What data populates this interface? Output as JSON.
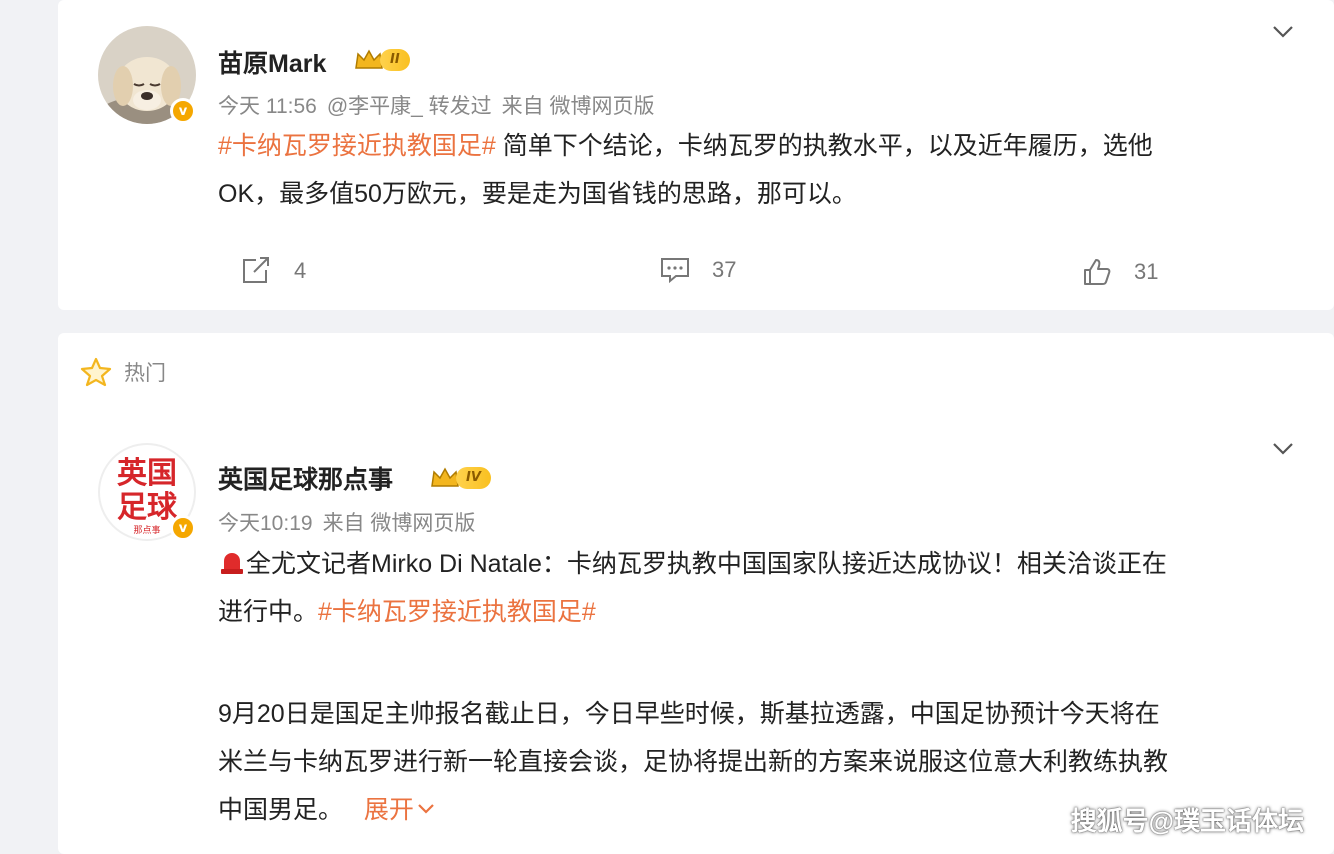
{
  "post1": {
    "author": "苗原Mark",
    "level": "II",
    "time": "今天 11:56",
    "repost_from": "@李平康_ 转发过",
    "source": "来自 微博网页版",
    "hashtag": "#卡纳瓦罗接近执教国足#",
    "text_line1": " 简单下个结论，卡纳瓦罗的执教水平，以及近年履历，选他",
    "text_line2": "OK，最多值50万欧元，要是走为国省钱的思路，那可以。",
    "repost_count": "4",
    "comment_count": "37",
    "like_count": "31"
  },
  "section": {
    "hot_label": "热门"
  },
  "post2": {
    "author": "英国足球那点事",
    "avatar_text_top": "英国",
    "avatar_text_bottom": "足球",
    "avatar_sub": "那点事",
    "level": "IV",
    "time": "今天10:19",
    "source": "来自 微博网页版",
    "para1_line1": "全尤文记者Mirko Di Natale：卡纳瓦罗执教中国国家队接近达成协议！相关洽谈正在",
    "para1_line2_prefix": "进行中。",
    "hashtag": "#卡纳瓦罗接近执教国足#",
    "para2_line1": "9月20日是国足主帅报名截止日，今日早些时候，斯基拉透露，中国足协预计今天将在",
    "para2_line2": "米兰与卡纳瓦罗进行新一轮直接会谈，足协将提出新的方案来说服这位意大利教练执教",
    "para2_line3": "中国男足。",
    "expand_label": "展开"
  },
  "watermark": "搜狐号@璞玉话体坛",
  "colors": {
    "accent_orange": "#eb7340",
    "verified_badge": "#f5a700",
    "background": "#f1f2f5"
  },
  "icons": [
    "chevron-down-icon",
    "repost-icon",
    "comment-icon",
    "like-icon",
    "star-icon",
    "crown-icon",
    "siren-icon",
    "verified-icon"
  ]
}
